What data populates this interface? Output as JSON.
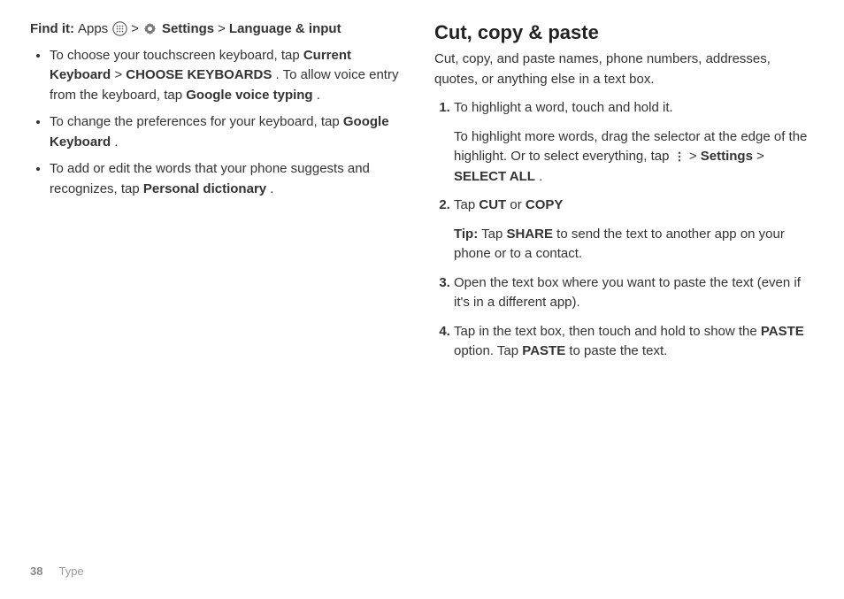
{
  "left": {
    "find_label": "Find it:",
    "apps_label": "Apps",
    "gt1": ">",
    "settings_label": "Settings",
    "gt2": ">",
    "lang_input": "Language & input",
    "bullets": [
      {
        "pre": "To choose your touchscreen keyboard, tap ",
        "b1": "Current Keyboard",
        "mid1": " > ",
        "b2": "CHOOSE KEYBOARDS",
        "mid2": ". To allow voice entry from the keyboard, tap ",
        "b3": "Google voice typing",
        "post": "."
      },
      {
        "pre": "To change the preferences for your keyboard, tap ",
        "b1": "Google Keyboard",
        "post": "."
      },
      {
        "pre": "To add or edit the words that your phone suggests and recognizes, tap ",
        "b1": "Personal dictionary",
        "post": "."
      }
    ]
  },
  "right": {
    "heading": "Cut, copy & paste",
    "intro": "Cut, copy, and paste names, phone numbers, addresses, quotes, or anything else in a text box.",
    "steps": {
      "s1a": "To highlight a word, touch and hold it.",
      "s1b_pre": "To highlight more words, drag the selector at the edge of the highlight. Or to select everything, tap ",
      "s1b_gt1": " > ",
      "s1b_settings": "Settings",
      "s1b_gt2": " > ",
      "s1b_selectall": "SELECT ALL",
      "s1b_post": ".",
      "s2_pre": "Tap ",
      "s2_cut": "CUT",
      "s2_or": " or ",
      "s2_copy": "COPY",
      "s2tip_label": "Tip:",
      "s2tip_pre": " Tap ",
      "s2tip_share": "SHARE",
      "s2tip_post": " to send the text to another app on your phone or to a contact.",
      "s3": "Open the text box where you want to paste the text (even if it's in a different app).",
      "s4_pre": "Tap in the text box, then touch and hold to show the ",
      "s4_paste1": "PASTE",
      "s4_mid": " option. Tap ",
      "s4_paste2": "PASTE",
      "s4_post": " to paste the text."
    }
  },
  "footer": {
    "page": "38",
    "section": "Type"
  }
}
